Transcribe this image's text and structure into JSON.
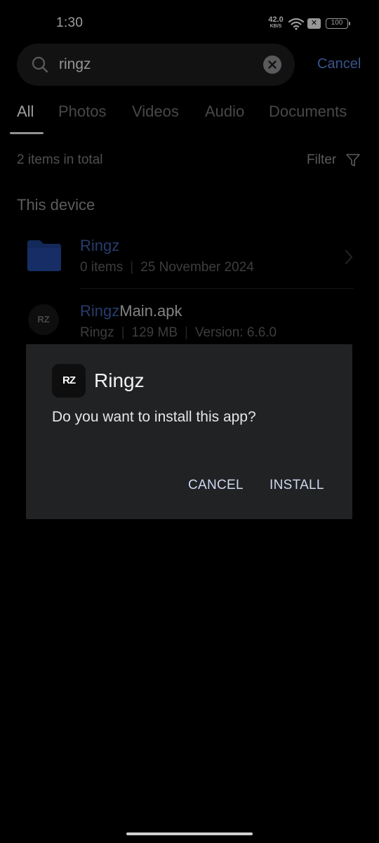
{
  "status_bar": {
    "time": "1:30",
    "net_speed_value": "42.0",
    "net_speed_unit": "KB/S",
    "x_badge": "✕",
    "battery": "100"
  },
  "search": {
    "query": "ringz",
    "cancel_label": "Cancel"
  },
  "tabs": [
    "All",
    "Photos",
    "Videos",
    "Audio",
    "Documents"
  ],
  "results": {
    "total_text": "2 items in total",
    "filter_label": "Filter",
    "section_title": "This device"
  },
  "items": [
    {
      "name_highlight": "Ringz",
      "name_rest": "",
      "meta": [
        "0 items",
        "25 November 2024"
      ]
    },
    {
      "icon_text": "RZ",
      "name_highlight": "Ringz",
      "name_rest": "Main.apk",
      "meta": [
        "Ringz",
        "129 MB",
        "Version: 6.6.0"
      ]
    }
  ],
  "dialog": {
    "app_icon_text": "RZ",
    "title": "Ringz",
    "question": "Do you want to install this app?",
    "cancel_label": "CANCEL",
    "install_label": "INSTALL"
  },
  "colors": {
    "accent": "#5b7fd9",
    "highlight": "#3c5da8",
    "folder": "#1e3f8a",
    "dialog_bg": "#212224"
  }
}
